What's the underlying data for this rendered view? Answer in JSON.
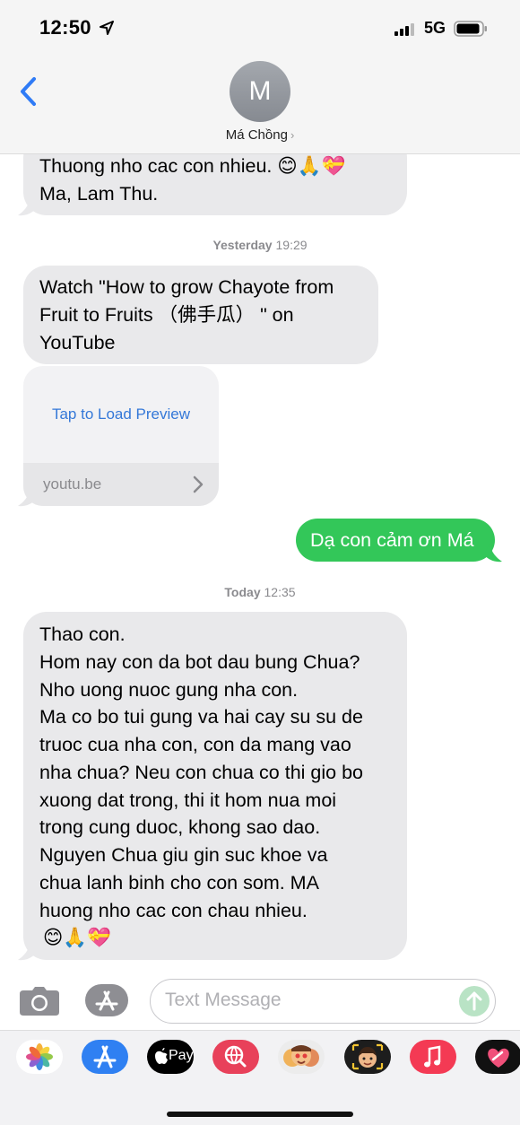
{
  "status_bar": {
    "time": "12:50",
    "network": "5G"
  },
  "header": {
    "avatar_initial": "M",
    "contact_name": "Má Chồng",
    "chevron": "›"
  },
  "messages": {
    "m1_line1": "Thuong nho cac con nhieu. 😊🙏💝",
    "m1_line2": "Ma, Lam Thu.",
    "ts1_day": "Yesterday",
    "ts1_time": "19:29",
    "m2_line1": "Watch \"How to grow Chayote from",
    "m2_line2": "Fruit to Fruits （佛手瓜） \" on",
    "m2_line3": "YouTube",
    "preview_link": "Tap to Load Preview",
    "preview_domain": "youtu.be",
    "m3_sent": "Dạ con cảm ơn Má",
    "ts2_day": "Today",
    "ts2_time": "12:35",
    "m4_lines": [
      "Thao con.",
      "Hom nay con da bot dau bung Chua?",
      "Nho uong nuoc gung nha con.",
      "Ma co bo tui gung va hai cay su su de",
      "truoc cua nha con, con da mang vao",
      "nha chua? Neu con chua co thi gio bo",
      "xuong dat trong, thi it hom nua moi",
      "trong cung duoc, khong sao dao.",
      "Nguyen Chua giu gin suc khoe va",
      "chua lanh binh cho con som. MA",
      "huong nho cac con chau nhieu.",
      "😊🙏💝"
    ]
  },
  "input": {
    "placeholder": "Text Message"
  },
  "drawer": {
    "apps": [
      "photos-app-icon",
      "app-store-app-icon",
      "apple-pay-app-icon",
      "search-images-app-icon",
      "memoji-stickers-app-icon",
      "memoji-app-icon",
      "music-app-icon",
      "digital-touch-app-icon"
    ],
    "apple_pay_label": "Pay"
  },
  "colors": {
    "sent_bubble": "#33c759",
    "received_bubble": "#e9e9eb",
    "ios_blue": "#2f7bf6",
    "link": "#3478d8"
  }
}
